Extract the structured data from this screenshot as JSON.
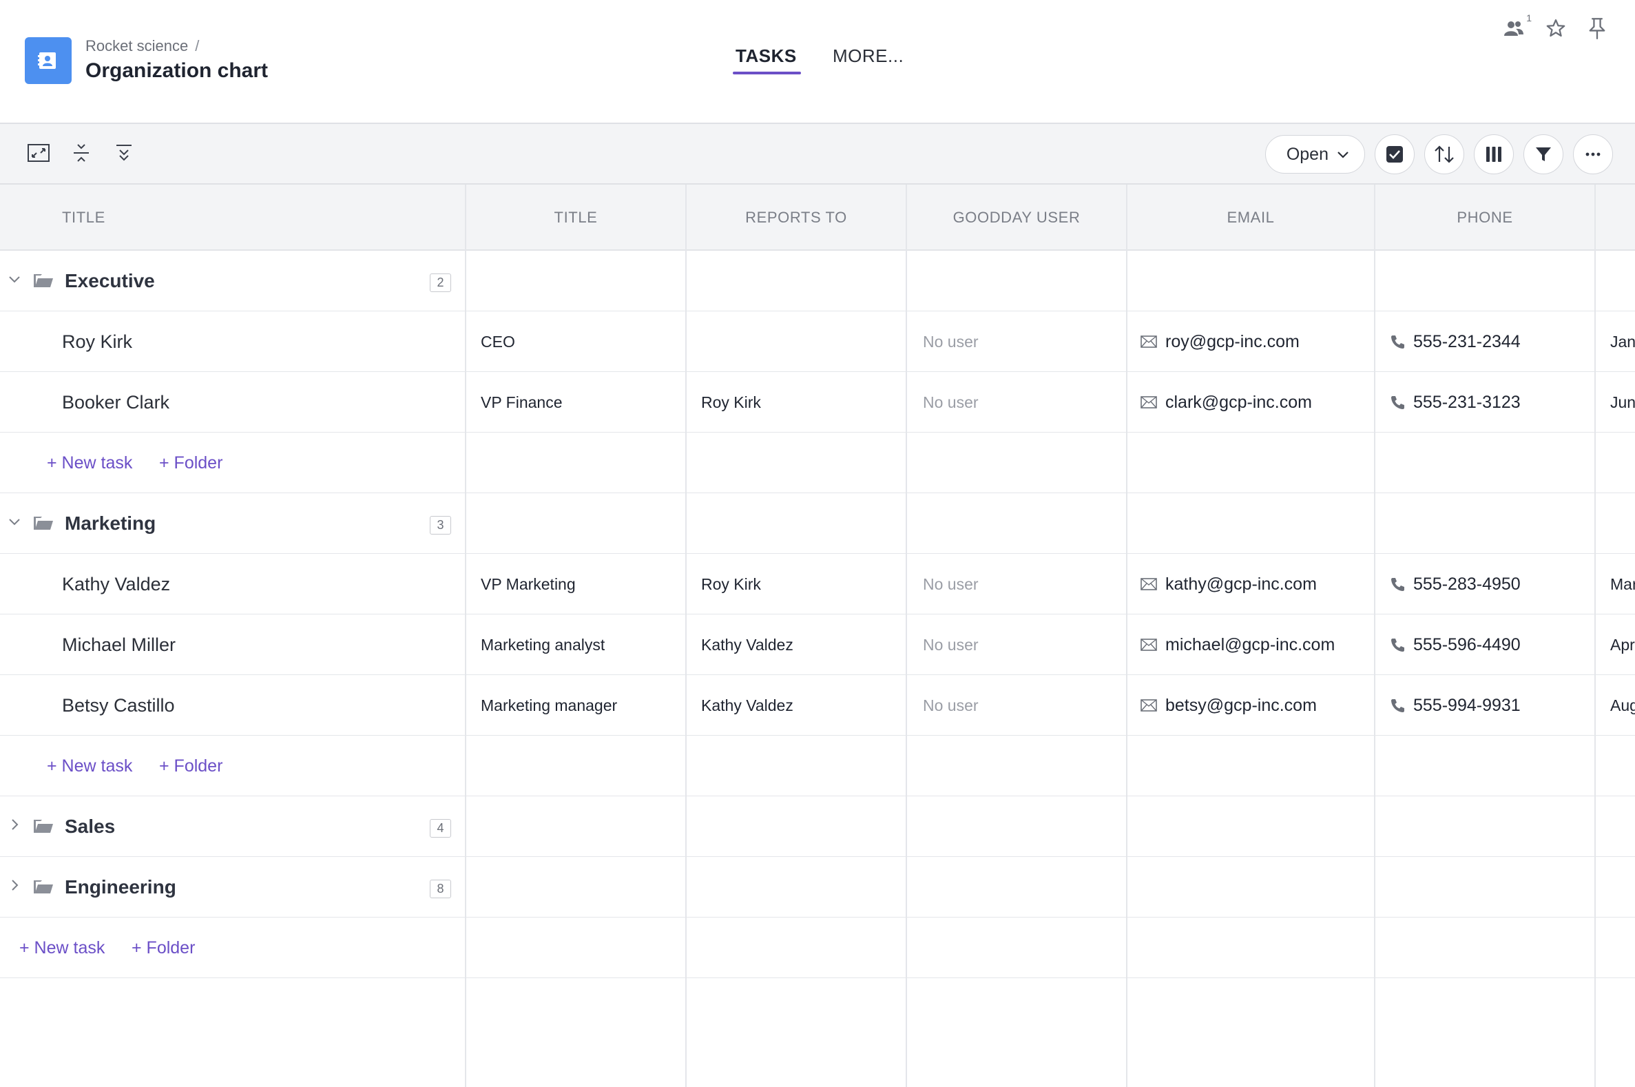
{
  "header": {
    "breadcrumb": "Rocket science",
    "breadcrumb_sep": "/",
    "title": "Organization chart",
    "tabs": [
      {
        "label": "TASKS",
        "active": true
      },
      {
        "label": "MORE..."
      }
    ],
    "users_count": "1",
    "icons": [
      "users-icon",
      "star-icon",
      "pin-icon"
    ]
  },
  "toolbar": {
    "left_icons": [
      "expand-icon",
      "collapse-all-icon",
      "expand-all-icon"
    ],
    "status_filter": "Open",
    "right_icons": [
      "checkbox-icon",
      "sort-icon",
      "columns-icon",
      "filter-icon",
      "more-icon"
    ]
  },
  "columns": [
    "TITLE",
    "TITLE",
    "REPORTS TO",
    "GOODDAY USER",
    "EMAIL",
    "PHONE"
  ],
  "add_task_label": "+ New task",
  "add_folder_label": "+ Folder",
  "groups": [
    {
      "name": "Executive",
      "count": "2",
      "expanded": true,
      "tasks": [
        {
          "name": "Roy Kirk",
          "title": "CEO",
          "reports_to": "",
          "user": "No user",
          "email": "roy@gcp-inc.com",
          "phone": "555-231-2344",
          "month": "Jan"
        },
        {
          "name": "Booker Clark",
          "title": "VP Finance",
          "reports_to": "Roy Kirk",
          "user": "No user",
          "email": "clark@gcp-inc.com",
          "phone": "555-231-3123",
          "month": "Jun"
        }
      ]
    },
    {
      "name": "Marketing",
      "count": "3",
      "expanded": true,
      "tasks": [
        {
          "name": "Kathy Valdez",
          "title": "VP Marketing",
          "reports_to": "Roy Kirk",
          "user": "No user",
          "email": "kathy@gcp-inc.com",
          "phone": "555-283-4950",
          "month": "Mar"
        },
        {
          "name": "Michael Miller",
          "title": "Marketing analyst",
          "reports_to": "Kathy Valdez",
          "user": "No user",
          "email": "michael@gcp-inc.com",
          "phone": "555-596-4490",
          "month": "Apr"
        },
        {
          "name": "Betsy Castillo",
          "title": "Marketing manager",
          "reports_to": "Kathy Valdez",
          "user": "No user",
          "email": "betsy@gcp-inc.com",
          "phone": "555-994-9931",
          "month": "Aug"
        }
      ]
    },
    {
      "name": "Sales",
      "count": "4",
      "expanded": false,
      "tasks": []
    },
    {
      "name": "Engineering",
      "count": "8",
      "expanded": false,
      "tasks": []
    }
  ],
  "colors": {
    "accent": "#6b4fc7",
    "project_icon": "#4d90f0"
  }
}
